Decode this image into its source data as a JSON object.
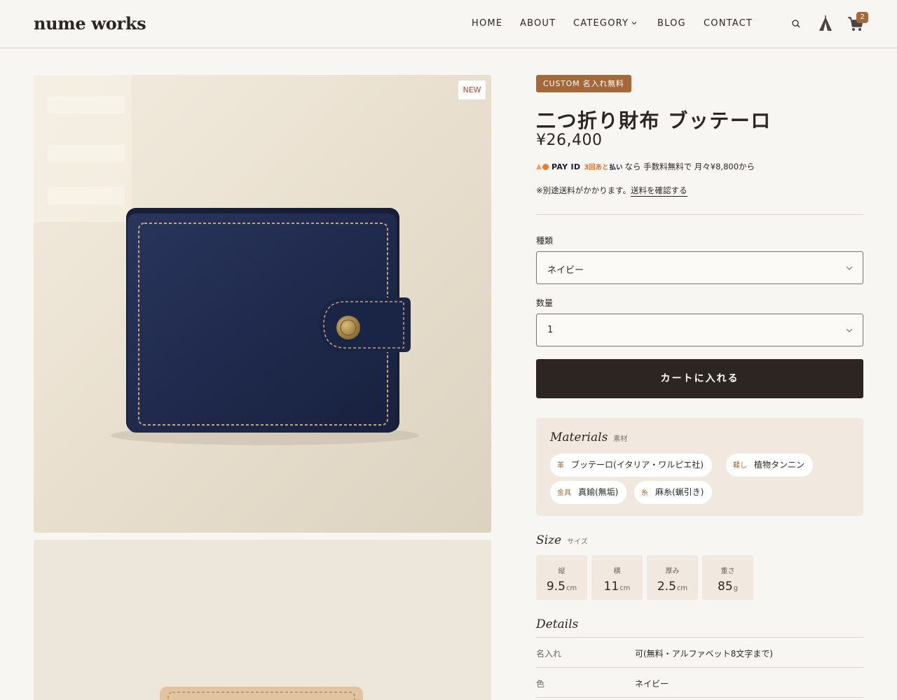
{
  "header": {
    "logo": "nume works",
    "nav": [
      "HOME",
      "ABOUT",
      "CATEGORY",
      "BLOG",
      "CONTACT"
    ],
    "cart_count": "2",
    "icons": [
      "search-icon",
      "tent-icon",
      "cart-icon",
      "chevron-down-icon"
    ]
  },
  "gallery": {
    "new_badge": "NEW"
  },
  "product": {
    "tag": "CUSTOM  名入れ無料",
    "title": "二つ折り財布 ブッテーロ",
    "price": "¥26,400",
    "pay": {
      "brand": "PAY ID",
      "installment": "3回あと",
      "harai": "払い",
      "text": "なら 手数料無料で 月々¥8,800から"
    },
    "shipping_note": "※別途送料がかかります。",
    "shipping_link": "送料を確認する"
  },
  "form": {
    "type_label": "種類",
    "type_value": "ネイビー",
    "qty_label": "数量",
    "qty_value": "1",
    "add_to_cart": "カートに入れる"
  },
  "materials": {
    "heading": "Materials",
    "sub": "素材",
    "items": [
      {
        "key": "革",
        "value": "ブッテーロ(イタリア・ワルピエ社)"
      },
      {
        "key": "鞣し",
        "value": "植物タンニン"
      },
      {
        "key": "金具",
        "value": "真鍮(無垢)"
      },
      {
        "key": "糸",
        "value": "麻糸(蝋引き)"
      }
    ]
  },
  "size": {
    "heading": "Size",
    "sub": "サイズ",
    "items": [
      {
        "label": "縦",
        "value": "9.5",
        "unit": "cm"
      },
      {
        "label": "横",
        "value": "11",
        "unit": "cm"
      },
      {
        "label": "厚み",
        "value": "2.5",
        "unit": "cm"
      },
      {
        "label": "重さ",
        "value": "85",
        "unit": "g"
      }
    ]
  },
  "details": {
    "heading": "Details",
    "rows": [
      {
        "key": "名入れ",
        "value": "可(無料・アルファベット8文字まで)"
      },
      {
        "key": "色",
        "value": "ネイビー"
      }
    ]
  },
  "colors": {
    "accent": "#a4683a",
    "button": "#2c2521",
    "panel": "#f1e9df",
    "background": "#f8f6f2",
    "wallet": "#1f2a4d"
  }
}
